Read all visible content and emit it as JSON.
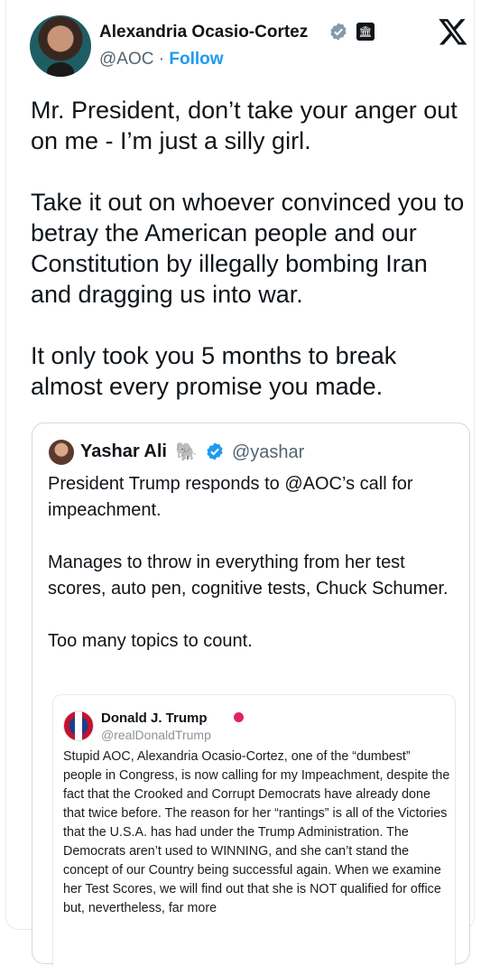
{
  "author": {
    "name": "Alexandria Ocasio-Cortez",
    "handle": "@AOC",
    "separator": " · ",
    "follow_label": "Follow",
    "avatar_icon": "avatar-photo",
    "badges": [
      "verified-badge-icon",
      "government-badge-icon"
    ]
  },
  "header": {
    "logo": "x-logo-icon"
  },
  "tweet": {
    "text": "Mr. President, don’t take your anger out on me - I’m just a silly girl.\n\nTake it out on whoever convinced you to betray the American people and our Constitution by illegally bombing Iran and dragging us into war.\n\nIt only took you 5 months to break almost every promise you made."
  },
  "quoted": {
    "name": "Yashar Ali",
    "emoji": "🐘",
    "handle": "@yashar",
    "text": "President Trump responds to @AOC’s call for impeachment.\n\nManages to throw in everything from her test scores, auto pen, cognitive tests, Chuck Schumer.\n\nToo many topics to count.",
    "embedded": {
      "name": "Donald J. Trump",
      "handle": "@realDonaldTrump",
      "text": "Stupid AOC, Alexandria Ocasio-Cortez, one of the “dumbest” people in Congress, is now calling for my Impeachment, despite the fact that the Crooked and Corrupt Democrats have already done that twice before. The reason for her “rantings” is all of the Victories that the U.S.A. has had under the Trump Administration. The Democrats aren’t used to WINNING, and she can’t stand the concept of our Country being successful again. When we examine her Test Scores, we will find out that she is NOT qualified for office but, nevertheless, far more"
    }
  },
  "colors": {
    "link": "#1d9bf0",
    "secondary_text": "#536471",
    "verified": "#829aab",
    "quote_verified": "#1d9bf0",
    "truth_badge": "#e0245e"
  }
}
